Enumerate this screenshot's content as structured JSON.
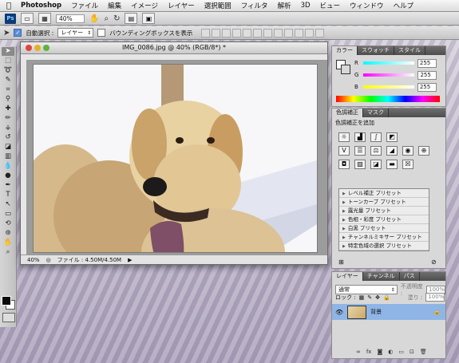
{
  "menubar": {
    "apple": "",
    "app_name": "Photoshop",
    "items": [
      "ファイル",
      "編集",
      "イメージ",
      "レイヤー",
      "選択範囲",
      "フィルタ",
      "解析",
      "3D",
      "ビュー",
      "ウィンドウ",
      "ヘルプ"
    ]
  },
  "appbar": {
    "logo": "Ps",
    "zoom": "40%"
  },
  "optionsbar": {
    "auto_select_label": "自動選択 :",
    "auto_select_value": "レイヤー",
    "bounding_box_label": "バウンディングボックスを表示"
  },
  "document": {
    "title": "IMG_0086.jpg @ 40% (RGB/8*) *",
    "status_zoom": "40%",
    "status_file": "ファイル : 4.50M/4.50M"
  },
  "color_panel": {
    "tabs": [
      "カラー",
      "スウォッチ",
      "スタイル"
    ],
    "r_label": "R",
    "g_label": "G",
    "b_label": "B",
    "r_value": "255",
    "g_value": "255",
    "b_value": "255"
  },
  "adjust_panel": {
    "tabs": [
      "色調補正",
      "マスク"
    ],
    "header": "色調補正を追加",
    "presets": [
      "レベル補正 プリセット",
      "トーンカーブ プリセット",
      "露光量 プリセット",
      "色相・彩度 プリセット",
      "白黒 プリセット",
      "チャンネルミキサー プリセット",
      "特定色域の選択 プリセット"
    ]
  },
  "layers_panel": {
    "tabs": [
      "レイヤー",
      "チャンネル",
      "パス"
    ],
    "blend_mode": "通常",
    "opacity_label": "不透明度 :",
    "opacity_value": "100%",
    "lock_label": "ロック :",
    "fill_label": "塗り :",
    "fill_value": "100%",
    "layer_name": "背景"
  },
  "colors": {
    "highlight_blue": "#8fb5e6",
    "ps_blue": "#0d3b78",
    "foreground": "#0a0a0a",
    "background": "#ffffff"
  }
}
